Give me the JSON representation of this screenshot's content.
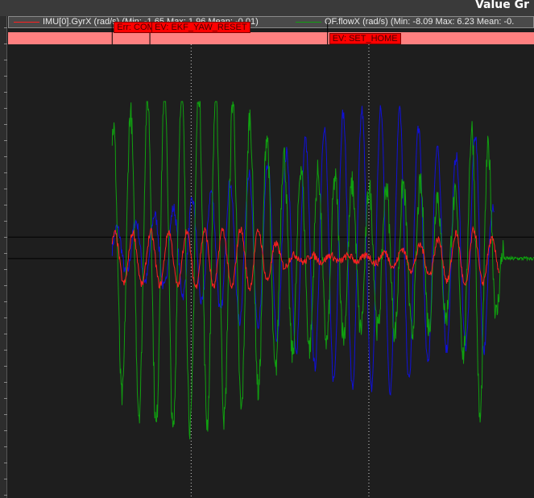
{
  "header": {
    "title": "Value Gr"
  },
  "legend": [
    {
      "label": "IMU[0].GyrX (rad/s)  (Min: -1.65 Max: 1.96 Mean: -0.01)",
      "color": "#ff2020"
    },
    {
      "label": "OF.flowX (rad/s)  (Min: -8.09 Max: 6.23 Mean: -0.",
      "color": "#10a010"
    }
  ],
  "events": [
    {
      "label": "Err: COM",
      "x": 0.0
    },
    {
      "label": "EV: EKF_YAW_RESET",
      "x": 2.1
    },
    {
      "label": "EV: SET_HOME",
      "x": 12.0
    }
  ],
  "chart_data": {
    "type": "line",
    "title": "",
    "xlabel": "",
    "ylabel": "",
    "xlim": [
      -5.8,
      23.5
    ],
    "ylim": [
      -9.5,
      8.5
    ],
    "vlines": [
      4.4,
      14.3
    ],
    "hlines": [
      0,
      0.85
    ],
    "series": [
      {
        "name": "IMU[0].GyrX (rad/s)",
        "color": "#ff2020",
        "x_range": [
          0,
          21.6
        ],
        "min": -1.65,
        "max": 1.96,
        "mean": -0.01
      },
      {
        "name": "OF.flowX (rad/s)",
        "color": "#10a010",
        "x_range": [
          0,
          23.5
        ],
        "min": -8.09,
        "max": 6.23
      },
      {
        "name": "",
        "color": "#1010d8",
        "x_range": [
          0,
          21.3
        ]
      }
    ]
  }
}
